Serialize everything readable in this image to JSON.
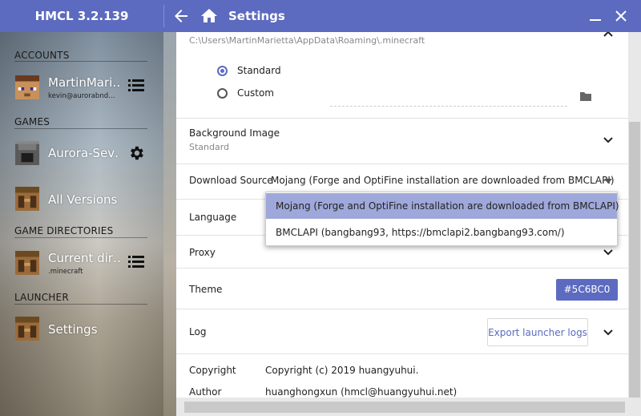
{
  "app": {
    "title": "HMCL 3.2.139",
    "accent": "#5C6BC0"
  },
  "header": {
    "page_title": "Settings"
  },
  "sidebar": {
    "accounts_header": "ACCOUNTS",
    "account": {
      "name": "MartinMari…",
      "email": "kevin@aurorabnd…"
    },
    "games_header": "GAMES",
    "game": {
      "name": "Aurora-Sev…"
    },
    "all_versions": "All Versions",
    "game_dirs_header": "GAME DIRECTORIES",
    "game_dir": {
      "name": "Current dir…",
      "sub": ".minecraft"
    },
    "launcher_header": "LAUNCHER",
    "settings": "Settings"
  },
  "settings": {
    "game_dir_path": "C:\\Users\\MartinMarietta\\AppData\\Roaming\\.minecraft",
    "radio_standard": "Standard",
    "radio_custom": "Custom",
    "background_label": "Background Image",
    "background_value": "Standard",
    "download_label": "Download Source",
    "download_value": "Mojang (Forge and OptiFine installation are downloaded from BMCLAPI)",
    "language_label": "Language",
    "proxy_label": "Proxy",
    "theme_label": "Theme",
    "theme_value": "#5C6BC0",
    "log_label": "Log",
    "export_logs": "Export launcher logs",
    "copyright_label": "Copyright",
    "copyright_value": "Copyright (c) 2019 huangyuhui.",
    "author_label": "Author",
    "author_value": "huanghongxun (hmcl@huangyuhui.net)"
  },
  "dropdown": {
    "options": [
      "Mojang (Forge and OptiFine installation are downloaded from BMCLAPI)",
      "BMCLAPI (bangbang93, https://bmclapi2.bangbang93.com/)"
    ]
  }
}
